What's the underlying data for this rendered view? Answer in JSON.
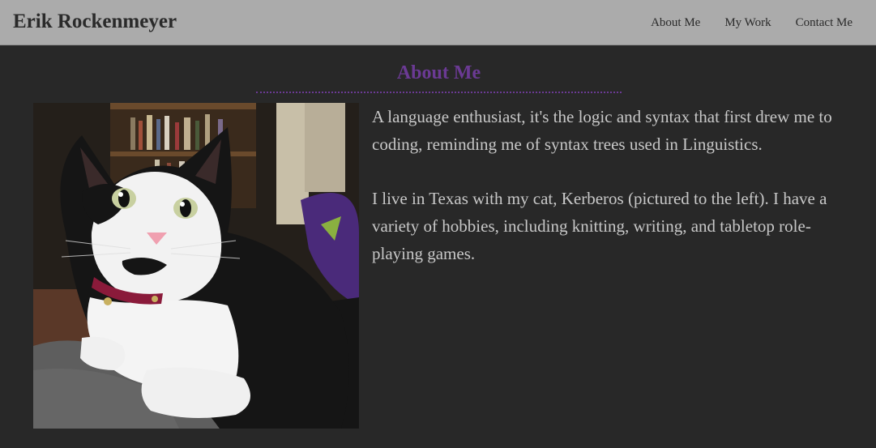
{
  "header": {
    "site_title": "Erik Rockenmeyer",
    "nav": [
      {
        "label": "About Me"
      },
      {
        "label": "My Work"
      },
      {
        "label": "Contact Me"
      }
    ]
  },
  "main": {
    "section_title": "About Me",
    "photo_alt": "Kerberos the cat",
    "paragraphs": [
      "A language enthusiast, it's the logic and syntax that first drew me to coding, reminding me of syntax trees used in Linguistics.",
      "I live in Texas with my cat, Kerberos (pictured to the left). I have a variety of hobbies, including knitting, writing, and tabletop role-playing games."
    ]
  },
  "colors": {
    "header_bg": "#ababab",
    "page_bg": "#282828",
    "accent": "#6b3a94",
    "body_text": "#c8c8c8"
  }
}
